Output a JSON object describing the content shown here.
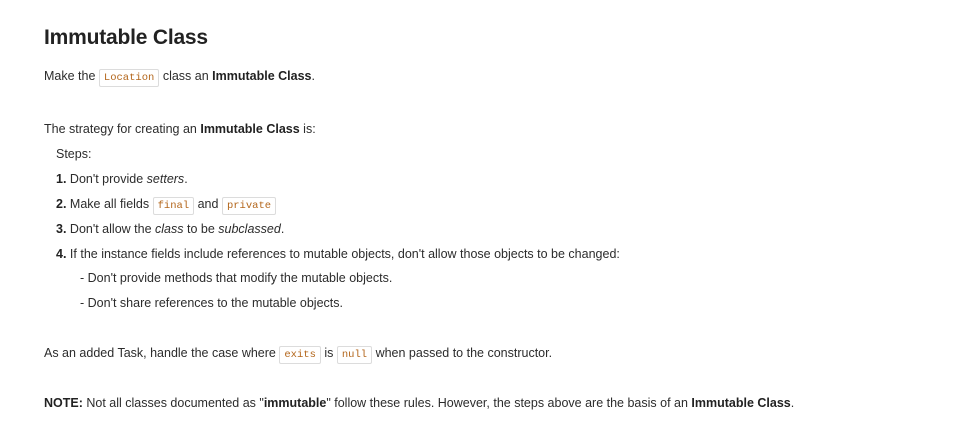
{
  "title": "Immutable Class",
  "intro": {
    "before": "Make the",
    "code": "Location",
    "middle": "class an",
    "bold": "Immutable Class",
    "after": "."
  },
  "strategy": {
    "before": "The strategy for creating an",
    "bold": "Immutable Class",
    "after": "is:"
  },
  "steps_label": "Steps:",
  "steps": [
    {
      "num": "1.",
      "text_a": "Don't provide",
      "em": "setters",
      "text_b": "."
    },
    {
      "num": "2.",
      "text_a": "Make all fields",
      "code1": "final",
      "and": "and",
      "code2": "private"
    },
    {
      "num": "3.",
      "text_a": "Don't allow the",
      "em1": "class",
      "text_b": "to be",
      "em2": "subclassed",
      "text_c": "."
    },
    {
      "num": "4.",
      "text": "If the instance fields include references to mutable objects, don't allow those objects to be changed:"
    }
  ],
  "substeps": [
    {
      "dash": "-",
      "text": "Don't provide methods that modify the mutable objects."
    },
    {
      "dash": "-",
      "text": "Don't share references to the mutable objects."
    }
  ],
  "task": {
    "before": "As an added Task, handle the case where",
    "code1": "exits",
    "middle": "is",
    "code2": "null",
    "after": "when passed to the constructor."
  },
  "note": {
    "label": "NOTE:",
    "before": "Not all classes documented as \"",
    "bold": "immutable",
    "middle": "\" follow these rules. However, the steps above are the basis of an",
    "bold2": "Immutable Class",
    "after": "."
  }
}
